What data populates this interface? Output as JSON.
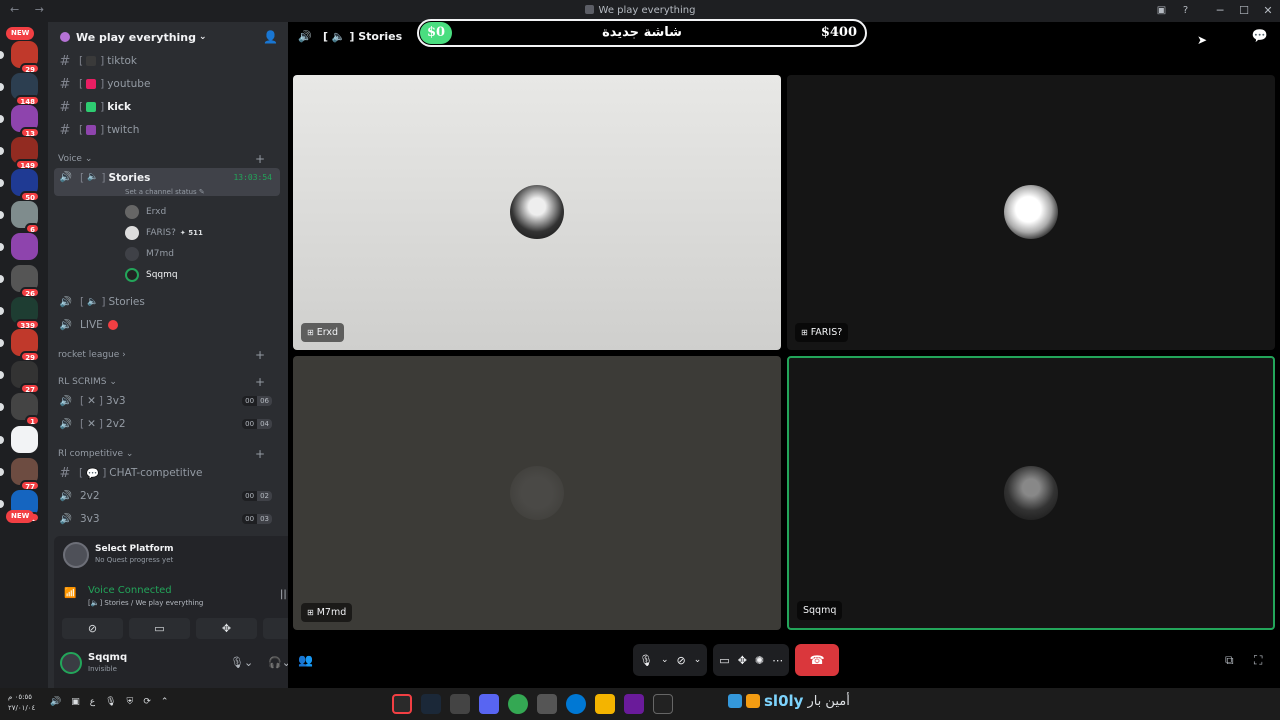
{
  "window": {
    "title": "We play everything",
    "nav": "← →"
  },
  "rail": {
    "new_badge_top": "NEW",
    "new_badge_bottom": "NEW",
    "servers": [
      {
        "badge": "29",
        "color": "#c0392b"
      },
      {
        "badge": "148",
        "color": "#2c3e50"
      },
      {
        "badge": "13",
        "color": "#8e44ad"
      },
      {
        "badge": "149",
        "color": "#922b21"
      },
      {
        "badge": "50",
        "color": "#1f3a93"
      },
      {
        "badge": "6",
        "color": "#7f8c8d"
      },
      {
        "badge": "",
        "color": "#8e44ad"
      },
      {
        "badge": "26",
        "color": "#555"
      },
      {
        "badge": "339",
        "color": "#1e3d32"
      },
      {
        "badge": "29",
        "color": "#c0392b"
      },
      {
        "badge": "27",
        "color": "#333"
      },
      {
        "badge": "1",
        "color": "#444"
      },
      {
        "badge": "",
        "color": "#f2f3f5"
      },
      {
        "badge": "77",
        "color": "#6d4c41"
      },
      {
        "badge": "1",
        "color": "#1565c0"
      }
    ]
  },
  "guild": {
    "name": "We play everything"
  },
  "channels": {
    "text": [
      {
        "label": "tiktok",
        "color": "#3a3a3a"
      },
      {
        "label": "youtube",
        "color": "#e91e63"
      },
      {
        "label": "kick",
        "color": "#2ecc71"
      },
      {
        "label": "twitch",
        "color": "#8e44ad"
      }
    ],
    "voice_category": "Voice",
    "stories_active": "Stories",
    "stories_timer": "13:03:54",
    "channel_status": "Set a channel status",
    "members": [
      {
        "name": "Erxd",
        "extra": ""
      },
      {
        "name": "FARIS?",
        "extra": "511"
      },
      {
        "name": "M7md",
        "extra": ""
      },
      {
        "name": "Sqqmq",
        "extra": ""
      }
    ],
    "stories_2": "Stories",
    "live": "LIVE",
    "cat_rocket": "rocket league",
    "cat_scrims": "RL SCRIMS",
    "scrims": [
      {
        "label": "3v3",
        "a": "00",
        "b": "06"
      },
      {
        "label": "2v2",
        "a": "00",
        "b": "04"
      }
    ],
    "cat_comp": "Rl competitive",
    "comp_chat": "CHAT-competitive",
    "comp_voice": [
      {
        "label": "2v2",
        "a": "00",
        "b": "02"
      },
      {
        "label": "3v3",
        "a": "00",
        "b": "03"
      }
    ]
  },
  "quest": {
    "title": "Select Platform",
    "subtitle": "No Quest progress yet"
  },
  "voice_panel": {
    "title": "Voice Connected",
    "subtitle": "Stories / We play everything"
  },
  "user": {
    "name": "Sqqmq",
    "status": "Invisible"
  },
  "main": {
    "channel_name": "Stories",
    "overlay": {
      "left": "$0",
      "middle": "شاشة جديدة",
      "right": "$400"
    },
    "tiles": [
      {
        "name": "Erxd"
      },
      {
        "name": "FARIS?"
      },
      {
        "name": "M7md"
      },
      {
        "name": "Sqqmq"
      }
    ]
  },
  "taskbar": {
    "time": "٠٥:٥٥ م",
    "date": "٢٧/٠١/٠٤",
    "ticker_brand": "sl0ly",
    "ticker_text": "أمين بار"
  }
}
